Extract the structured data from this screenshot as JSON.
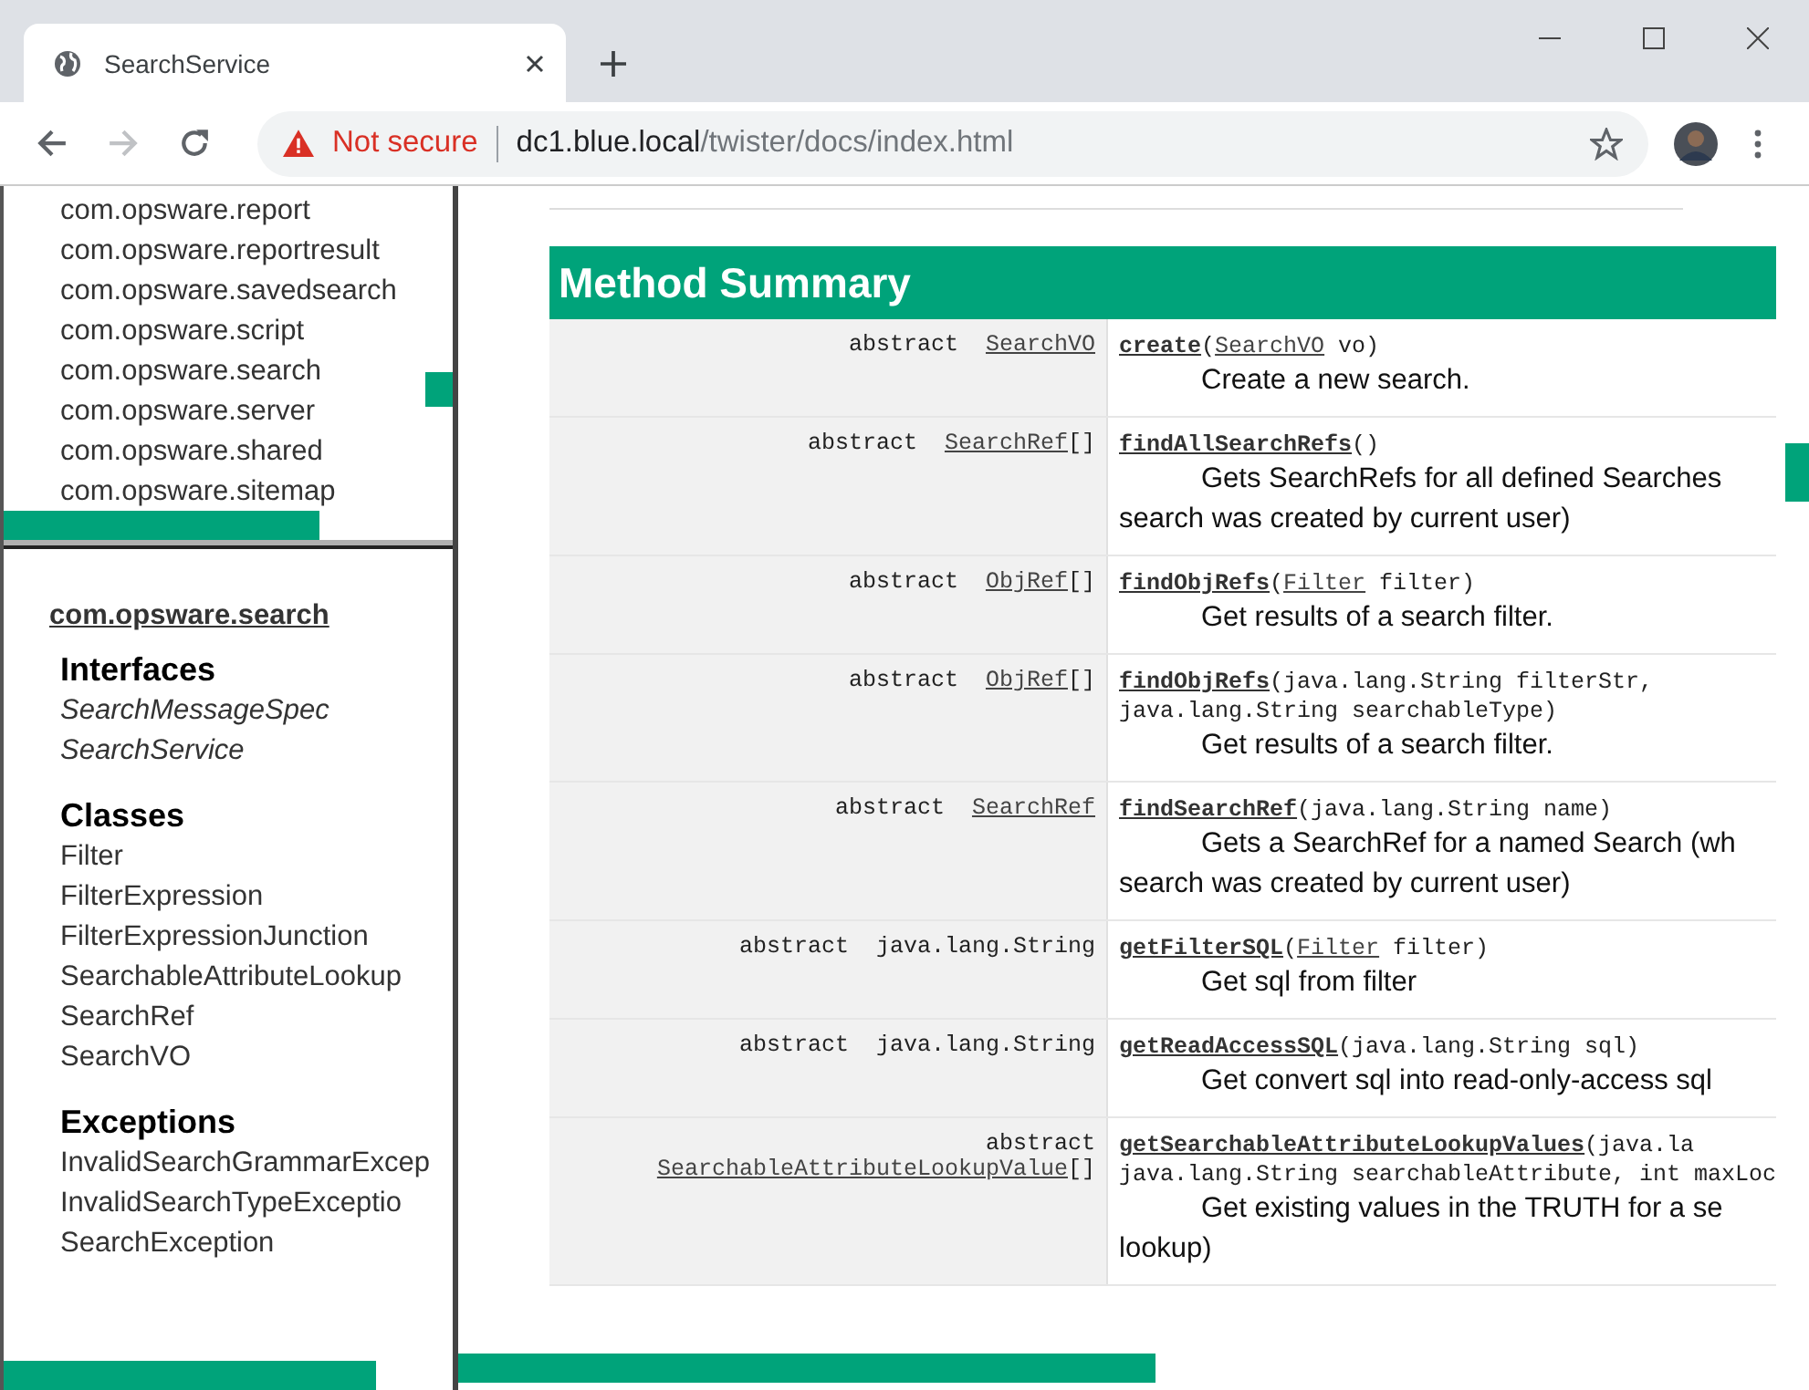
{
  "window": {
    "tab_title": "SearchService",
    "address": {
      "warning": "Not secure",
      "host": "dc1.blue.local",
      "path": "/twister/docs/index.html"
    }
  },
  "packages": [
    "com.opsware.report",
    "com.opsware.reportresult",
    "com.opsware.savedsearch",
    "com.opsware.script",
    "com.opsware.search",
    "com.opsware.server",
    "com.opsware.shared",
    "com.opsware.sitemap"
  ],
  "package_frame": {
    "title": "com.opsware.search",
    "sections": [
      {
        "heading": "Interfaces",
        "kind": "interface",
        "items": [
          "SearchMessageSpec",
          "SearchService"
        ]
      },
      {
        "heading": "Classes",
        "kind": "class",
        "items": [
          "Filter",
          "FilterExpression",
          "FilterExpressionJunction",
          "SearchableAttributeLookup",
          "SearchRef",
          "SearchVO"
        ]
      },
      {
        "heading": "Exceptions",
        "kind": "class",
        "items": [
          "InvalidSearchGrammarExcep",
          "InvalidSearchTypeExceptio",
          "SearchException"
        ]
      }
    ]
  },
  "method_summary": {
    "title": "Method Summary",
    "rows": [
      {
        "modifier": "abstract",
        "type": [
          {
            "text": "SearchVO",
            "kind": "link"
          }
        ],
        "signature": [
          [
            {
              "text": "create",
              "kind": "method"
            },
            {
              "text": "(",
              "kind": "plain"
            },
            {
              "text": "SearchVO",
              "kind": "link"
            },
            {
              "text": " vo)",
              "kind": "plain"
            }
          ]
        ],
        "description": [
          "Create a new search."
        ]
      },
      {
        "modifier": "abstract",
        "type": [
          {
            "text": "SearchRef",
            "kind": "link"
          },
          {
            "text": "[]",
            "kind": "plain"
          }
        ],
        "signature": [
          [
            {
              "text": "findAllSearchRefs",
              "kind": "method"
            },
            {
              "text": "()",
              "kind": "plain"
            }
          ]
        ],
        "description": [
          "Gets SearchRefs for all defined Searches",
          "search was created by current user)"
        ]
      },
      {
        "modifier": "abstract",
        "type": [
          {
            "text": "ObjRef",
            "kind": "link"
          },
          {
            "text": "[]",
            "kind": "plain"
          }
        ],
        "signature": [
          [
            {
              "text": "findObjRefs",
              "kind": "method"
            },
            {
              "text": "(",
              "kind": "plain"
            },
            {
              "text": "Filter",
              "kind": "link"
            },
            {
              "text": " filter)",
              "kind": "plain"
            }
          ]
        ],
        "description": [
          "Get results of a search filter."
        ]
      },
      {
        "modifier": "abstract",
        "type": [
          {
            "text": "ObjRef",
            "kind": "link"
          },
          {
            "text": "[]",
            "kind": "plain"
          }
        ],
        "signature": [
          [
            {
              "text": "findObjRefs",
              "kind": "method"
            },
            {
              "text": "(java.lang.String filterStr,",
              "kind": "plain"
            }
          ],
          [
            {
              "text": "java.lang.String searchableType)",
              "kind": "plain"
            }
          ]
        ],
        "description": [
          "Get results of a search filter."
        ]
      },
      {
        "modifier": "abstract",
        "type": [
          {
            "text": "SearchRef",
            "kind": "link"
          }
        ],
        "signature": [
          [
            {
              "text": "findSearchRef",
              "kind": "method"
            },
            {
              "text": "(java.lang.String name)",
              "kind": "plain"
            }
          ]
        ],
        "description": [
          "Gets a SearchRef for a named Search (wh",
          "search was created by current user)"
        ]
      },
      {
        "modifier": "abstract",
        "type": [
          {
            "text": "java.lang.String",
            "kind": "plain"
          }
        ],
        "signature": [
          [
            {
              "text": "getFilterSQL",
              "kind": "method"
            },
            {
              "text": "(",
              "kind": "plain"
            },
            {
              "text": "Filter",
              "kind": "link"
            },
            {
              "text": " filter)",
              "kind": "plain"
            }
          ]
        ],
        "description": [
          "Get sql from filter"
        ]
      },
      {
        "modifier": "abstract",
        "type": [
          {
            "text": "java.lang.String",
            "kind": "plain"
          }
        ],
        "signature": [
          [
            {
              "text": "getReadAccessSQL",
              "kind": "method"
            },
            {
              "text": "(java.lang.String sql)",
              "kind": "plain"
            }
          ]
        ],
        "description": [
          "Get convert sql into read-only-access sql"
        ]
      },
      {
        "modifier": "abstract",
        "type": [
          {
            "text": "SearchableAttributeLookupValue",
            "kind": "link"
          },
          {
            "text": "[]",
            "kind": "plain"
          }
        ],
        "signature": [
          [
            {
              "text": "getSearchableAttributeLookupValues",
              "kind": "method"
            },
            {
              "text": "(java.la",
              "kind": "plain"
            }
          ],
          [
            {
              "text": "java.lang.String searchableAttribute, int maxLoc",
              "kind": "plain"
            }
          ]
        ],
        "description": [
          "Get existing values in the TRUTH for a se",
          "lookup)"
        ]
      }
    ]
  }
}
